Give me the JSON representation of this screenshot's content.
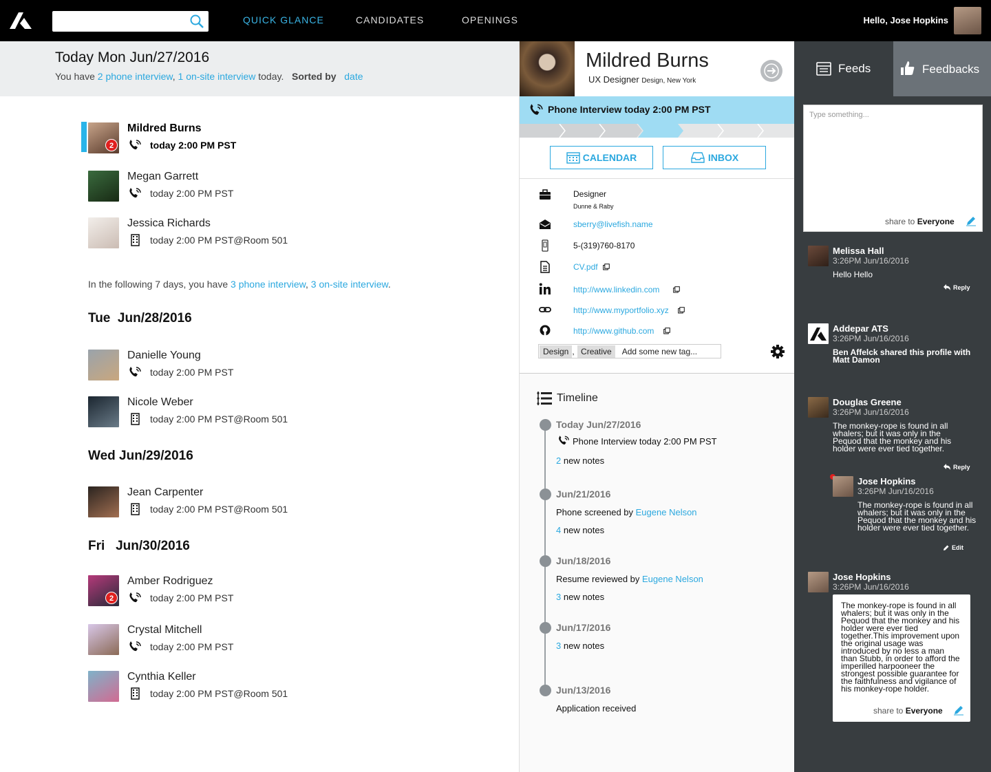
{
  "header": {
    "nav": [
      "QUICK GLANCE",
      "CANDIDATES",
      "OPENINGS"
    ],
    "greeting": "Hello, Jose Hopkins",
    "search_placeholder": "",
    "accent": "#3ab5e6"
  },
  "today": {
    "title": "Today Mon Jun/27/2016",
    "p1": "You have ",
    "phone_link": "2 phone interview",
    "sep": ", ",
    "onsite_link": "1 on-site interview",
    "p2": " today.",
    "sorted": "Sorted by",
    "sort_link": "date"
  },
  "list": [
    {
      "name": "Mildred Burns",
      "time": "today 2:00 PM PST",
      "type": "phone",
      "badge": "2"
    },
    {
      "name": "Megan Garrett",
      "time": "today 2:00 PM PST",
      "type": "phone"
    },
    {
      "name": "Jessica Richards",
      "time": "today 2:00 PM PST@Room 501",
      "type": "onsite"
    },
    {
      "name": "Danielle Young",
      "time": "today 2:00 PM PST",
      "type": "phone"
    },
    {
      "name": "Nicole Weber",
      "time": "today 2:00 PM PST@Room 501",
      "type": "onsite"
    },
    {
      "name": "Jean Carpenter",
      "time": "today 2:00 PM PST@Room 501",
      "type": "onsite"
    },
    {
      "name": "Amber Rodriguez",
      "time": "today 2:00 PM PST",
      "type": "phone",
      "badge": "2"
    },
    {
      "name": "Crystal Mitchell",
      "time": "today 2:00 PM PST",
      "type": "phone"
    },
    {
      "name": "Cynthia Keller",
      "time": "today 2:00 PM PST@Room 501",
      "type": "onsite"
    }
  ],
  "following": {
    "p1": "In the following 7 days, you have ",
    "phone": "3 phone interview",
    "sep": ", ",
    "onsite": "3 on-site interview",
    "end": "."
  },
  "days": [
    "Tue  Jun/28/2016",
    "Wed Jun/29/2016",
    "Fri   Jun/30/2016"
  ],
  "profile": {
    "name": "Mildred Burns",
    "title": "UX Designer",
    "location": "Design, New York",
    "interview": "Phone Interview today 2:00 PM PST",
    "calendar": "CALENDAR",
    "inbox": "INBOX",
    "role": "Designer",
    "company": "Dunne & Raby",
    "email": "sberry@livefish.name",
    "phone": "5-(319)760-8170",
    "cv": "CV.pdf",
    "linkedin": "http://www.linkedin.com",
    "portfolio": "http://www.myportfolio.xyz",
    "github": "http://www.github.com",
    "tags": [
      "Design",
      "Creative"
    ],
    "tag_sep": ",",
    "tag_placeholder": "Add some new tag..."
  },
  "timeline": {
    "title": "Timeline",
    "entries": [
      {
        "date": "Today Jun/27/2016",
        "event": "Phone Interview today 2:00 PM PST",
        "notes_n": "2",
        "notes": " new notes"
      },
      {
        "date": "Jun/21/2016",
        "event": "Phone screened by ",
        "person": "Eugene Nelson",
        "notes_n": "4",
        "notes": " new notes"
      },
      {
        "date": "Jun/18/2016",
        "event": "Resume reviewed by ",
        "person": "Eugene Nelson",
        "notes_n": "3",
        "notes": " new notes"
      },
      {
        "date": "Jun/17/2016",
        "notes_n": "3",
        "notes": " new notes"
      },
      {
        "date": "Jun/13/2016",
        "event": "Application received"
      }
    ]
  },
  "feeds": {
    "tab_feeds": "Feeds",
    "tab_feedbacks": "Feedbacks",
    "placeholder": "Type something...",
    "share_to": "share to",
    "everyone": "Everyone",
    "reply": "Reply",
    "edit": "Edit",
    "items": [
      {
        "name": "Melissa Hall",
        "time": "3:26PM Jun/16/2016",
        "text": "Hello Hello"
      },
      {
        "name": "Addepar ATS",
        "time": "3:26PM Jun/16/2016",
        "text": "Ben Affelck shared this profile with Matt Damon"
      },
      {
        "name": "Douglas Greene",
        "time": "3:26PM Jun/16/2016",
        "text": "The monkey-rope is found in all whalers; but it was only in the Pequod that the monkey and his holder were ever tied together."
      },
      {
        "name": "Jose Hopkins",
        "time": "3:26PM Jun/16/2016",
        "text": "The monkey-rope is found in all whalers; but it was only in the Pequod that the monkey and his holder were ever tied together."
      },
      {
        "name": "Jose Hopkins",
        "time": "3:26PM Jun/16/2016",
        "text": "The monkey-rope is found in all whalers; but it was only in the Pequod that the monkey and his holder were ever tied together.This improvement upon the original usage was introduced by no less a man than Stubb, in order to afford the imperilled harpooneer the strongest possible guarantee for the faithfulness and vigilance of his monkey-rope holder."
      }
    ]
  }
}
